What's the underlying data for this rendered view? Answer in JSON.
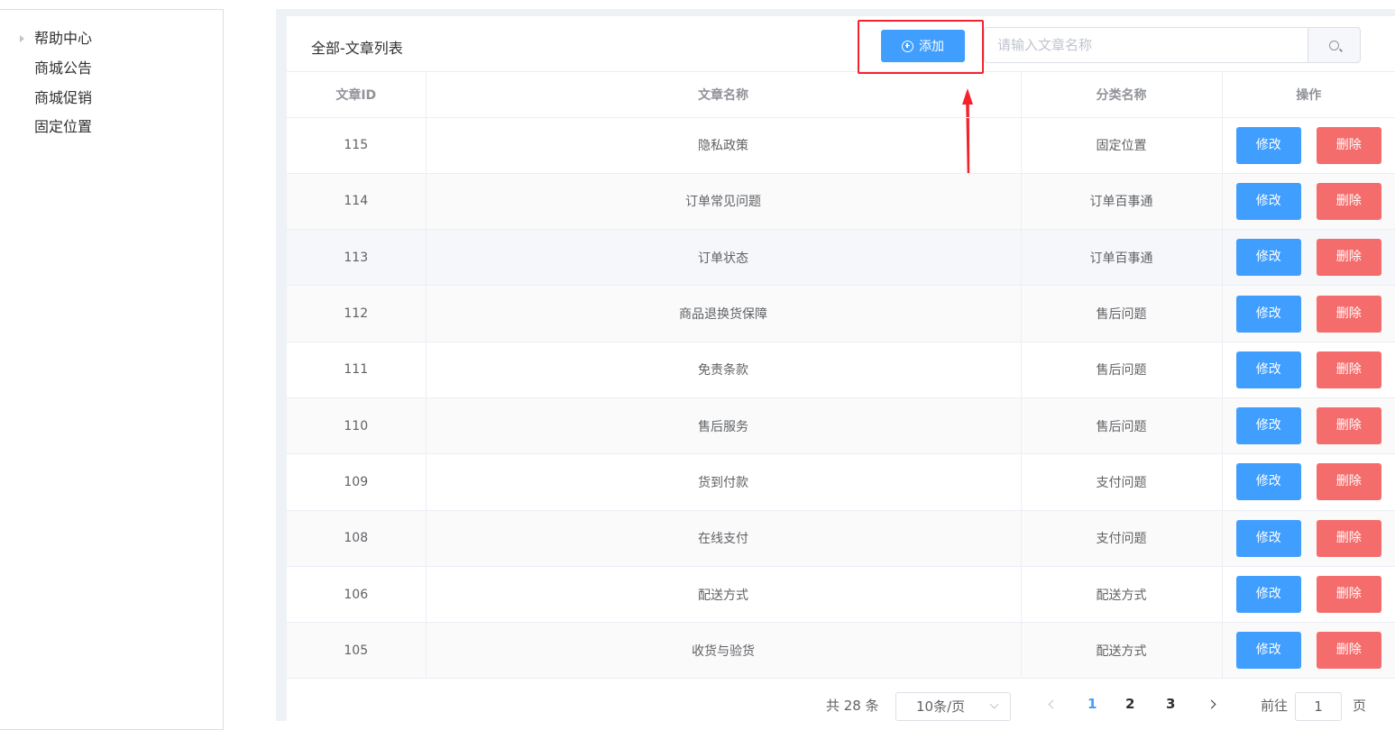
{
  "sidebar": {
    "items": [
      {
        "label": "帮助中心",
        "expandable": true
      },
      {
        "label": "商城公告"
      },
      {
        "label": "商城促销"
      },
      {
        "label": "固定位置"
      }
    ]
  },
  "header": {
    "title": "全部-文章列表",
    "add_label": "添加",
    "search_placeholder": "请输入文章名称"
  },
  "table": {
    "columns": [
      "文章ID",
      "文章名称",
      "分类名称",
      "操作"
    ],
    "edit_label": "修改",
    "delete_label": "删除",
    "rows": [
      {
        "id": "115",
        "name": "隐私政策",
        "category": "固定位置"
      },
      {
        "id": "114",
        "name": "订单常见问题",
        "category": "订单百事通"
      },
      {
        "id": "113",
        "name": "订单状态",
        "category": "订单百事通"
      },
      {
        "id": "112",
        "name": "商品退换货保障",
        "category": "售后问题"
      },
      {
        "id": "111",
        "name": "免责条款",
        "category": "售后问题"
      },
      {
        "id": "110",
        "name": "售后服务",
        "category": "售后问题"
      },
      {
        "id": "109",
        "name": "货到付款",
        "category": "支付问题"
      },
      {
        "id": "108",
        "name": "在线支付",
        "category": "支付问题"
      },
      {
        "id": "106",
        "name": "配送方式",
        "category": "配送方式"
      },
      {
        "id": "105",
        "name": "收货与验货",
        "category": "配送方式"
      }
    ]
  },
  "pagination": {
    "total": "共 28 条",
    "page_size": "10条/页",
    "pages": [
      "1",
      "2",
      "3"
    ],
    "current": "1",
    "goto_label": "前往",
    "goto_value": "1",
    "page_suffix": "页"
  },
  "colors": {
    "primary": "#409eff",
    "danger": "#f56c6c",
    "annotation": "#f5222d"
  }
}
